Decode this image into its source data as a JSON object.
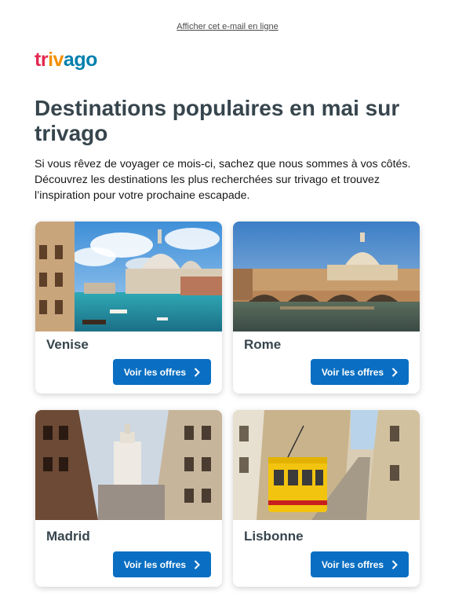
{
  "header": {
    "view_online": "Afficher cet e-mail en ligne",
    "logo_text": "trivago",
    "logo_colors": [
      "#e32851",
      "#f48f00",
      "#007fad"
    ]
  },
  "main": {
    "headline": "Destinations populaires en mai sur trivago",
    "intro": "Si vous rêvez de voyager ce mois-ci, sachez que nous sommes à vos côtés. Découvrez les destinations les plus recherchées sur trivago et trouvez l’inspiration pour votre prochaine escapade."
  },
  "cards": [
    {
      "city": "Venise",
      "button": "Voir les offres",
      "icon": "chevron-right-icon"
    },
    {
      "city": "Rome",
      "button": "Voir les offres",
      "icon": "chevron-right-icon"
    },
    {
      "city": "Madrid",
      "button": "Voir les offres",
      "icon": "chevron-right-icon"
    },
    {
      "city": "Lisbonne",
      "button": "Voir les offres",
      "icon": "chevron-right-icon"
    }
  ],
  "colors": {
    "button": "#0a6fc2",
    "heading": "#37454d"
  }
}
